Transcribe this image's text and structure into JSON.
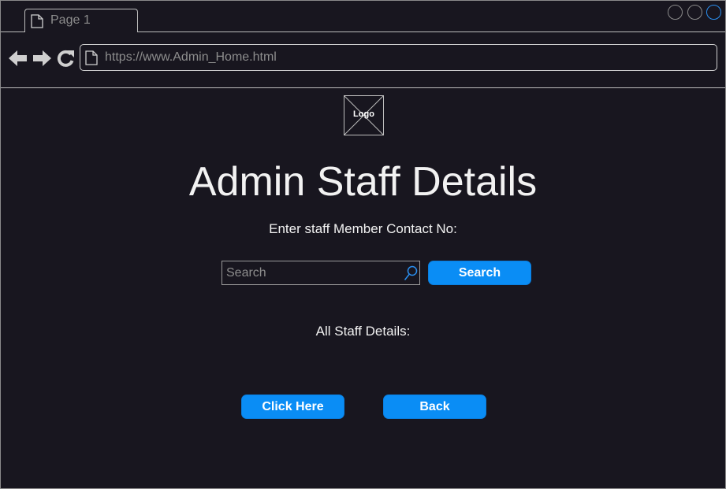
{
  "browser": {
    "tab_label": "Page 1",
    "url": "https://www.Admin_Home.html"
  },
  "page": {
    "logo_text": "Logo",
    "title": "Admin Staff Details",
    "contact_label": "Enter staff Member Contact No:",
    "search_placeholder": "Search",
    "search_button": "Search",
    "all_staff_label": "All Staff Details:",
    "click_here_button": "Click Here",
    "back_button": "Back"
  },
  "colors": {
    "background": "#18161f",
    "accent": "#0a8df5"
  }
}
